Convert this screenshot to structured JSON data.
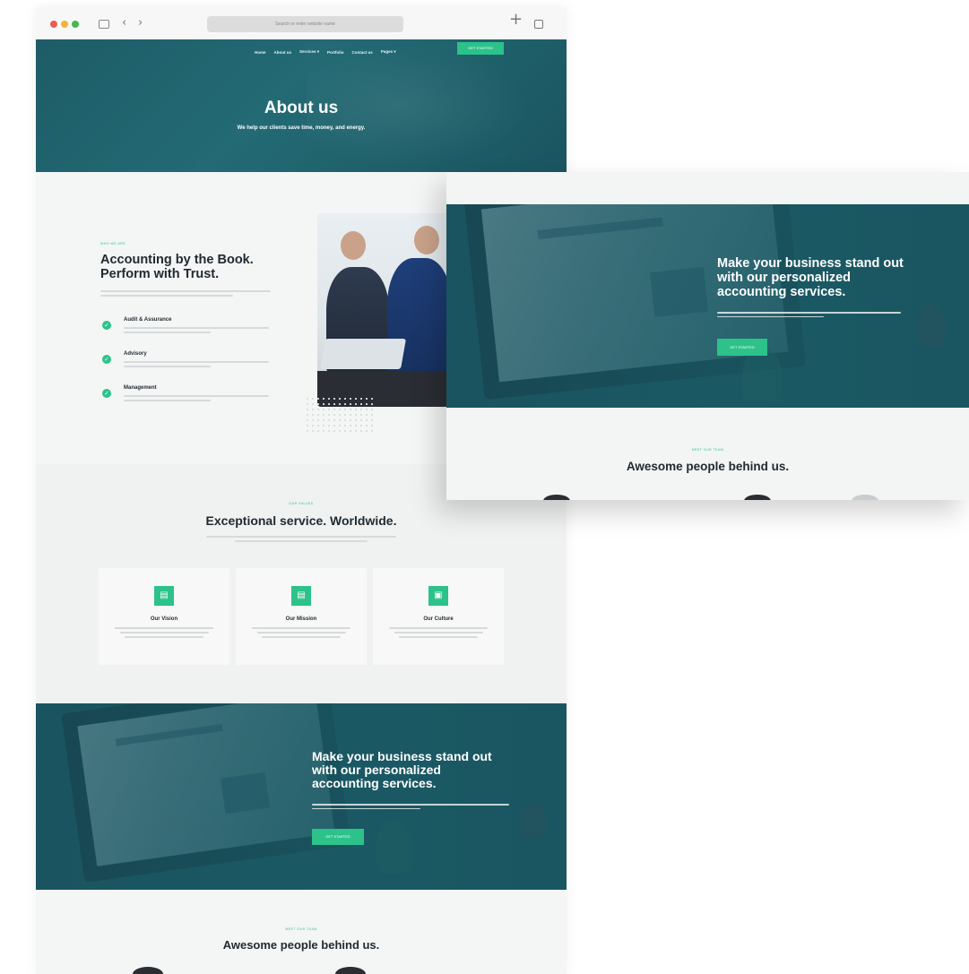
{
  "browser": {
    "url_placeholder": "Search or enter website name",
    "icons": [
      "sidebar-icon",
      "back-icon",
      "forward-icon",
      "plus-icon",
      "tabs-icon"
    ]
  },
  "nav": {
    "items": [
      "Home",
      "About us",
      "Services ▾",
      "Portfolio",
      "Contact us",
      "Pages ▾"
    ],
    "cta": "GET STARTED"
  },
  "hero": {
    "title": "About us",
    "subtitle": "We help our clients save time, money, and energy."
  },
  "about": {
    "eyebrow": "WHO WE ARE",
    "title": "Accounting by the Book. Perform with Trust.",
    "features": [
      {
        "title": "Audit & Assurance"
      },
      {
        "title": "Advisory"
      },
      {
        "title": "Management"
      }
    ]
  },
  "services": {
    "eyebrow": "OUR VALUES",
    "title": "Exceptional service. Worldwide.",
    "cards": [
      {
        "title": "Our Vision"
      },
      {
        "title": "Our Mission"
      },
      {
        "title": "Our Culture"
      }
    ]
  },
  "cta": {
    "title": "Make your business stand out with our personalized accounting services.",
    "button": "GET STARTED"
  },
  "team": {
    "eyebrow": "MEET OUR TEAM",
    "title": "Awesome people behind us."
  },
  "colors": {
    "accent": "#2cc28a",
    "brand_dark": "#1c5661",
    "heading": "#1e2a30",
    "background": "#f4f5f5"
  }
}
